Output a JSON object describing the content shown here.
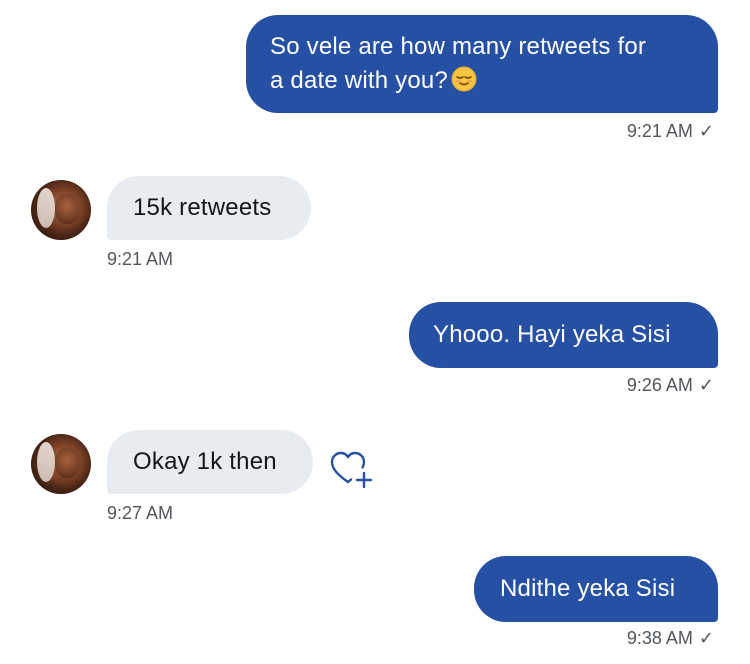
{
  "messages": [
    {
      "direction": "outgoing",
      "text_line1": "So vele are how many retweets for",
      "text_line2": "a date with you?",
      "emoji": "relieved-face-emoji",
      "time": "9:21 AM",
      "status": "✓"
    },
    {
      "direction": "incoming",
      "text": "15k retweets",
      "time": "9:21 AM"
    },
    {
      "direction": "outgoing",
      "text": "Yhooo. Hayi yeka Sisi",
      "time": "9:26 AM",
      "status": "✓"
    },
    {
      "direction": "incoming",
      "text": "Okay 1k then",
      "time": "9:27 AM",
      "reaction_icon": "heart-plus-icon"
    },
    {
      "direction": "outgoing",
      "text": "Ndithe yeka Sisi",
      "time": "9:38 AM",
      "status": "✓"
    }
  ],
  "colors": {
    "outgoing_bubble": "#2650a3",
    "incoming_bubble": "#e8ebef",
    "timestamp": "#52565b",
    "background": "#ffffff"
  }
}
